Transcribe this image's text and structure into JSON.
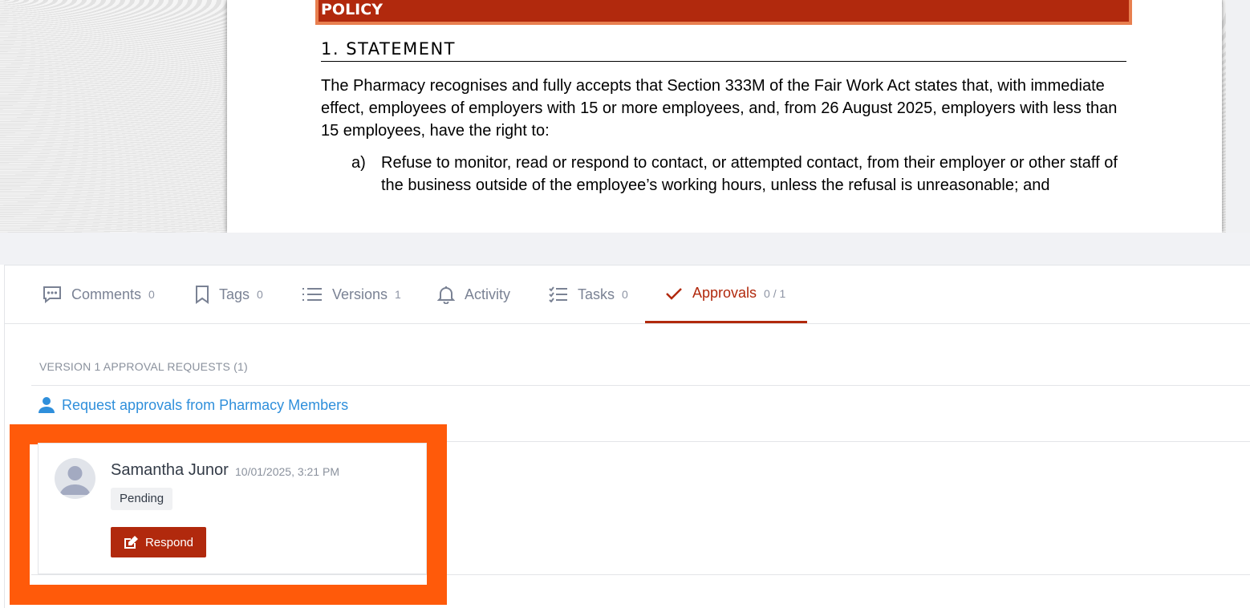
{
  "document": {
    "banner": "POLICY",
    "heading": "1. STATEMENT",
    "intro": "The Pharmacy recognises and fully accepts that Section 333M of the Fair Work Act states that, with immediate effect, employees of employers with 15 or more employees, and, from 26 August 2025, employers with less than 15 employees, have the right to:",
    "list": [
      {
        "marker": "a)",
        "text": "Refuse to monitor, read or respond to contact, or attempted contact, from their employer or other staff of the business outside of the employee’s working hours, unless the refusal is unreasonable; and"
      }
    ]
  },
  "tabs": [
    {
      "label": "Comments",
      "count": "0",
      "icon": "comment-icon"
    },
    {
      "label": "Tags",
      "count": "0",
      "icon": "bookmark-icon"
    },
    {
      "label": "Versions",
      "count": "1",
      "icon": "list-icon"
    },
    {
      "label": "Activity",
      "count": "",
      "icon": "bell-icon"
    },
    {
      "label": "Tasks",
      "count": "0",
      "icon": "checklist-icon"
    },
    {
      "label": "Approvals",
      "count": "0 / 1",
      "icon": "check-icon"
    }
  ],
  "active_tab": "Approvals",
  "approvals": {
    "section_heading": "VERSION 1 APPROVAL REQUESTS (1)",
    "request_link": "Request approvals from Pharmacy Members",
    "requests": [
      {
        "name": "Samantha Junor",
        "date": "10/01/2025, 3:21 PM",
        "status": "Pending",
        "action_label": "Respond"
      }
    ]
  },
  "colors": {
    "accent": "#b1290d",
    "highlight": "#ff5a0a",
    "link": "#2f8fdb",
    "muted": "#7a8294"
  }
}
